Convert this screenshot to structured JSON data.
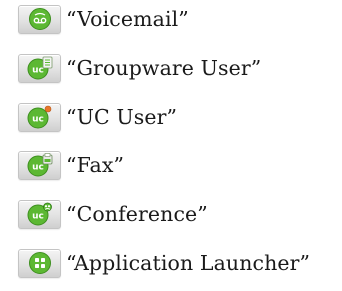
{
  "legend": {
    "items": [
      {
        "icon": "voicemail-icon",
        "label": "“Voicemail”"
      },
      {
        "icon": "groupware-user-icon",
        "label": "“Groupware User”"
      },
      {
        "icon": "uc-user-icon",
        "label": "“UC User”"
      },
      {
        "icon": "fax-icon",
        "label": "“Fax”"
      },
      {
        "icon": "conference-icon",
        "label": "“Conference”"
      },
      {
        "icon": "application-launcher-icon",
        "label": "“Application Launcher”"
      }
    ],
    "icon_text": "uc",
    "colors": {
      "green": "#5cb833",
      "green_dark": "#3d8f1f",
      "orange": "#e8772b",
      "tile": "#e2e2e2"
    }
  }
}
